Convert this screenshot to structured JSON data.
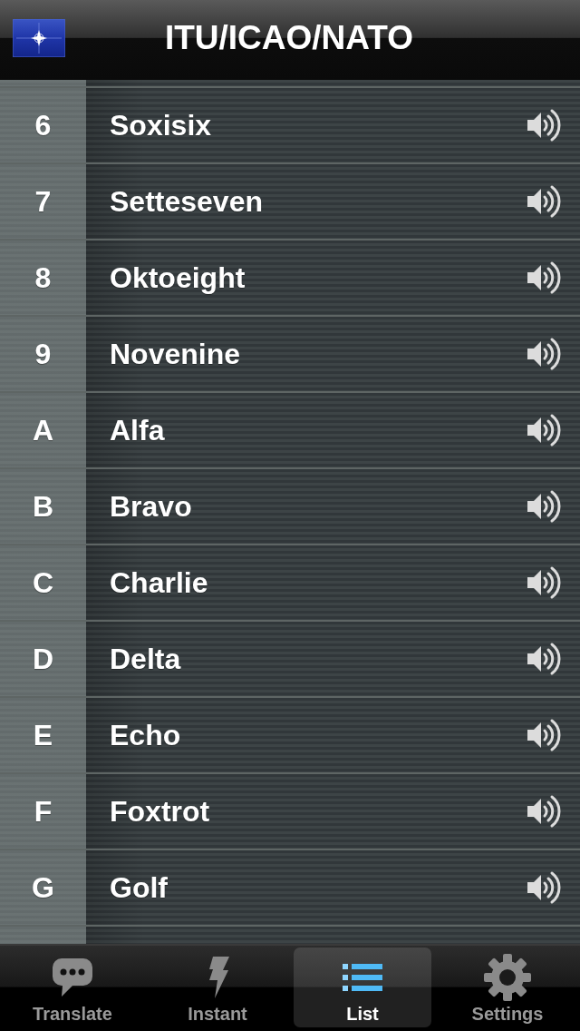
{
  "header": {
    "title": "ITU/ICAO/NATO"
  },
  "rows": [
    {
      "symbol": "6",
      "word": "Soxisix"
    },
    {
      "symbol": "7",
      "word": "Setteseven"
    },
    {
      "symbol": "8",
      "word": "Oktoeight"
    },
    {
      "symbol": "9",
      "word": "Novenine"
    },
    {
      "symbol": "A",
      "word": "Alfa"
    },
    {
      "symbol": "B",
      "word": "Bravo"
    },
    {
      "symbol": "C",
      "word": "Charlie"
    },
    {
      "symbol": "D",
      "word": "Delta"
    },
    {
      "symbol": "E",
      "word": "Echo"
    },
    {
      "symbol": "F",
      "word": "Foxtrot"
    },
    {
      "symbol": "G",
      "word": "Golf"
    }
  ],
  "tab_bar": {
    "tabs": [
      {
        "label": "Translate",
        "selected": false
      },
      {
        "label": "Instant",
        "selected": false
      },
      {
        "label": "List",
        "selected": true
      },
      {
        "label": "Settings",
        "selected": false
      }
    ]
  }
}
